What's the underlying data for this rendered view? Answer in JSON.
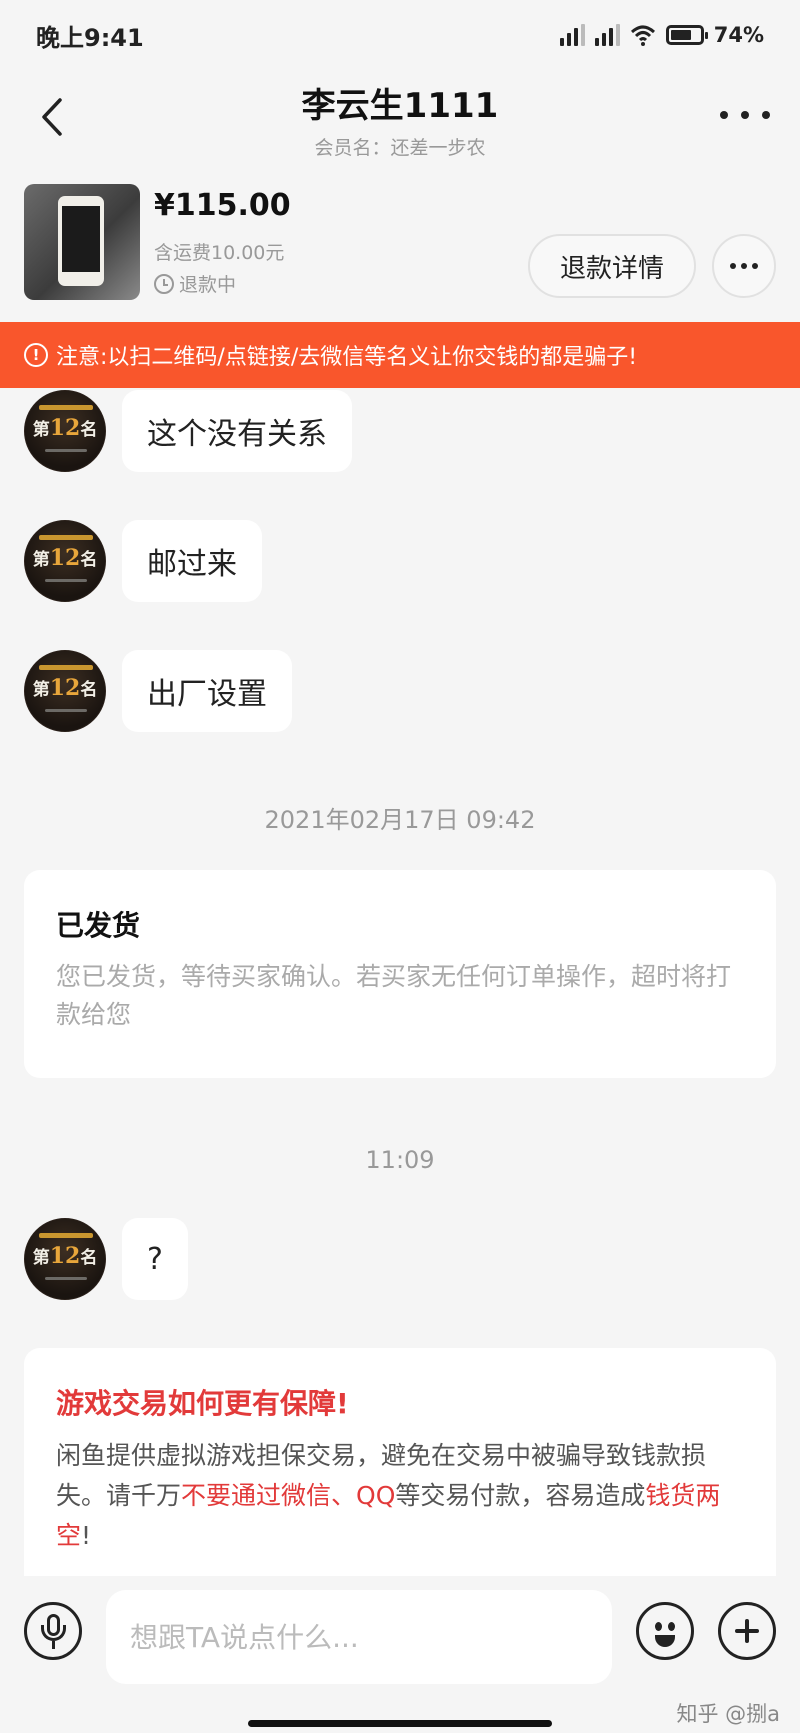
{
  "status_bar": {
    "time": "晚上9:41",
    "battery": "74%"
  },
  "header": {
    "title": "李云生1111",
    "subtitle": "会员名：还差一步农"
  },
  "product": {
    "price": "¥115.00",
    "shipping": "含运费10.00元",
    "status": "退款中",
    "refund_button": "退款详情"
  },
  "warning": "注意:以扫二维码/点链接/去微信等名义让你交钱的都是骗子!",
  "avatar": {
    "rank_prefix": "第",
    "rank_number": "12",
    "rank_suffix": "名"
  },
  "messages": [
    {
      "text": "这个没有关系"
    },
    {
      "text": "邮过来"
    },
    {
      "text": "出厂设置"
    }
  ],
  "timestamp_1": "2021年02月17日 09:42",
  "shipped_card": {
    "title": "已发货",
    "body": "您已发货，等待买家确认。若买家无任何订单操作，超时将打款给您"
  },
  "timestamp_2": "11:09",
  "message_4": {
    "text": "?"
  },
  "guarantee_card": {
    "title": "游戏交易如何更有保障!",
    "body_1": "闲鱼提供虚拟游戏担保交易，避免在交易中被骗导致钱款损失。请千万",
    "body_red_1": "不要通过微信、QQ",
    "body_2": "等交易付款，容易造成",
    "body_red_2": "钱货两空",
    "body_3": "!"
  },
  "input": {
    "placeholder": "想跟TA说点什么..."
  },
  "watermark": "知乎 @捌a"
}
